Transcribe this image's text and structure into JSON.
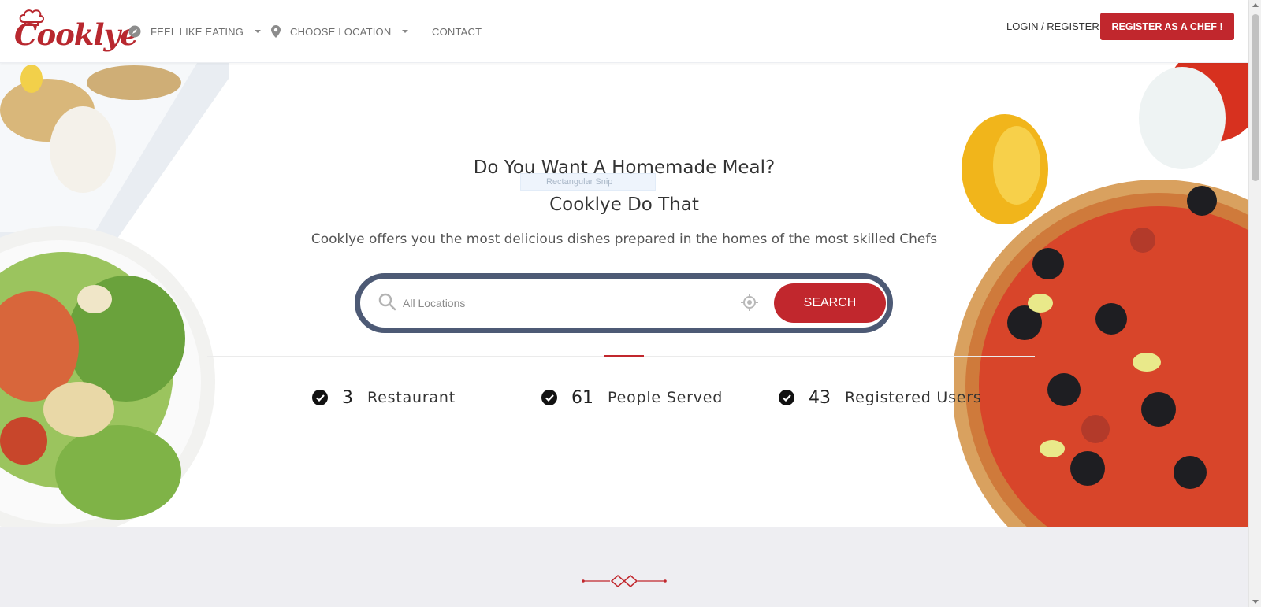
{
  "brand": {
    "logo_text": "Cooklye",
    "accent": "#c1272d",
    "frame": "#4d5a75"
  },
  "nav": {
    "items": [
      {
        "label": "FEEL LIKE EATING",
        "icon": "compass-icon"
      },
      {
        "label": "CHOOSE LOCATION",
        "icon": "map-pin-icon"
      },
      {
        "label": "CONTACT"
      }
    ],
    "login_label": "LOGIN / REGISTER",
    "register_chef_label": "REGISTER AS A CHEF !"
  },
  "hero": {
    "title_line1": "Do You Want A Homemade Meal?",
    "title_line2": "Cooklye Do That",
    "subtitle": "Cooklye offers you the most delicious dishes prepared in the homes of the most skilled Chefs",
    "snip_tooltip": "Rectangular Snip"
  },
  "search": {
    "placeholder": "All Locations",
    "value": "",
    "button_label": "SEARCH",
    "icon": "search-icon",
    "locate_icon": "crosshair-icon"
  },
  "stats": [
    {
      "number": "3",
      "label": "Restaurant",
      "icon": "check-circle-icon"
    },
    {
      "number": "61",
      "label": "People Served",
      "icon": "check-circle-icon"
    },
    {
      "number": "43",
      "label": "Registered Users",
      "icon": "check-circle-icon"
    }
  ]
}
